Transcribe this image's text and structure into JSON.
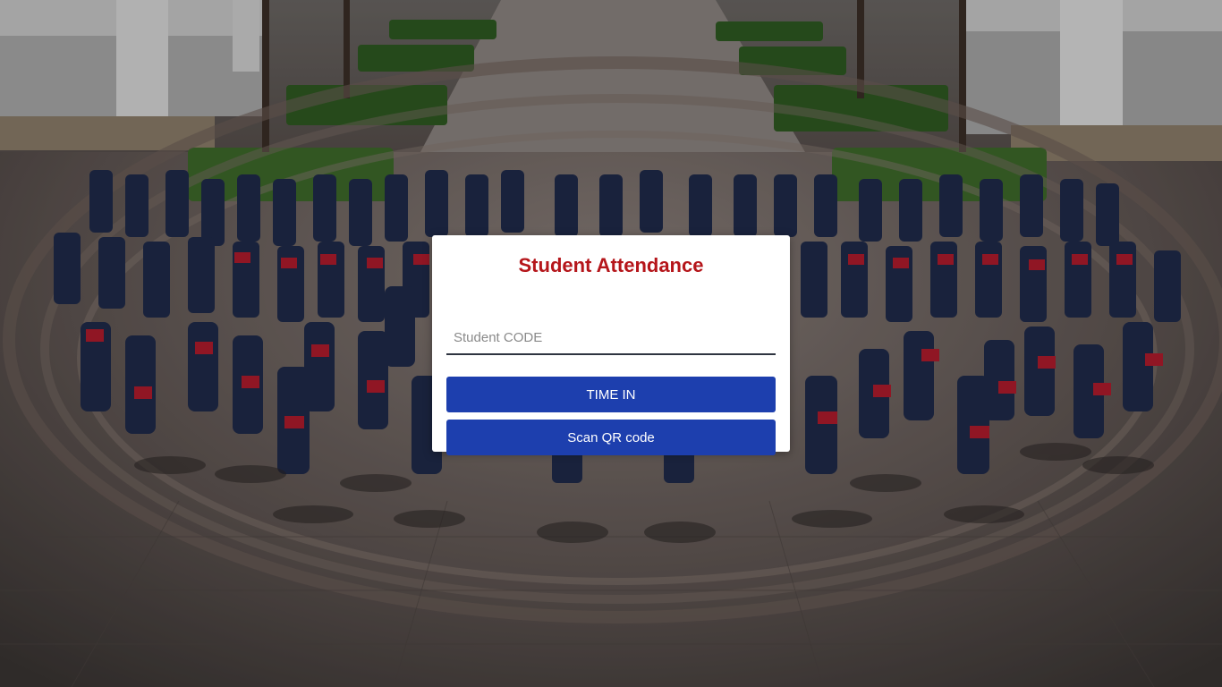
{
  "page": {
    "title": "Student Attendance"
  },
  "form": {
    "code_placeholder": "Student CODE",
    "code_value": "",
    "time_in_label": "TIME IN",
    "scan_qr_label": "Scan QR code"
  },
  "colors": {
    "title": "#b5161b",
    "button": "#1d3fae",
    "input_underline": "#2e3440"
  },
  "background": {
    "description_icon": "graduation-group-photo"
  }
}
